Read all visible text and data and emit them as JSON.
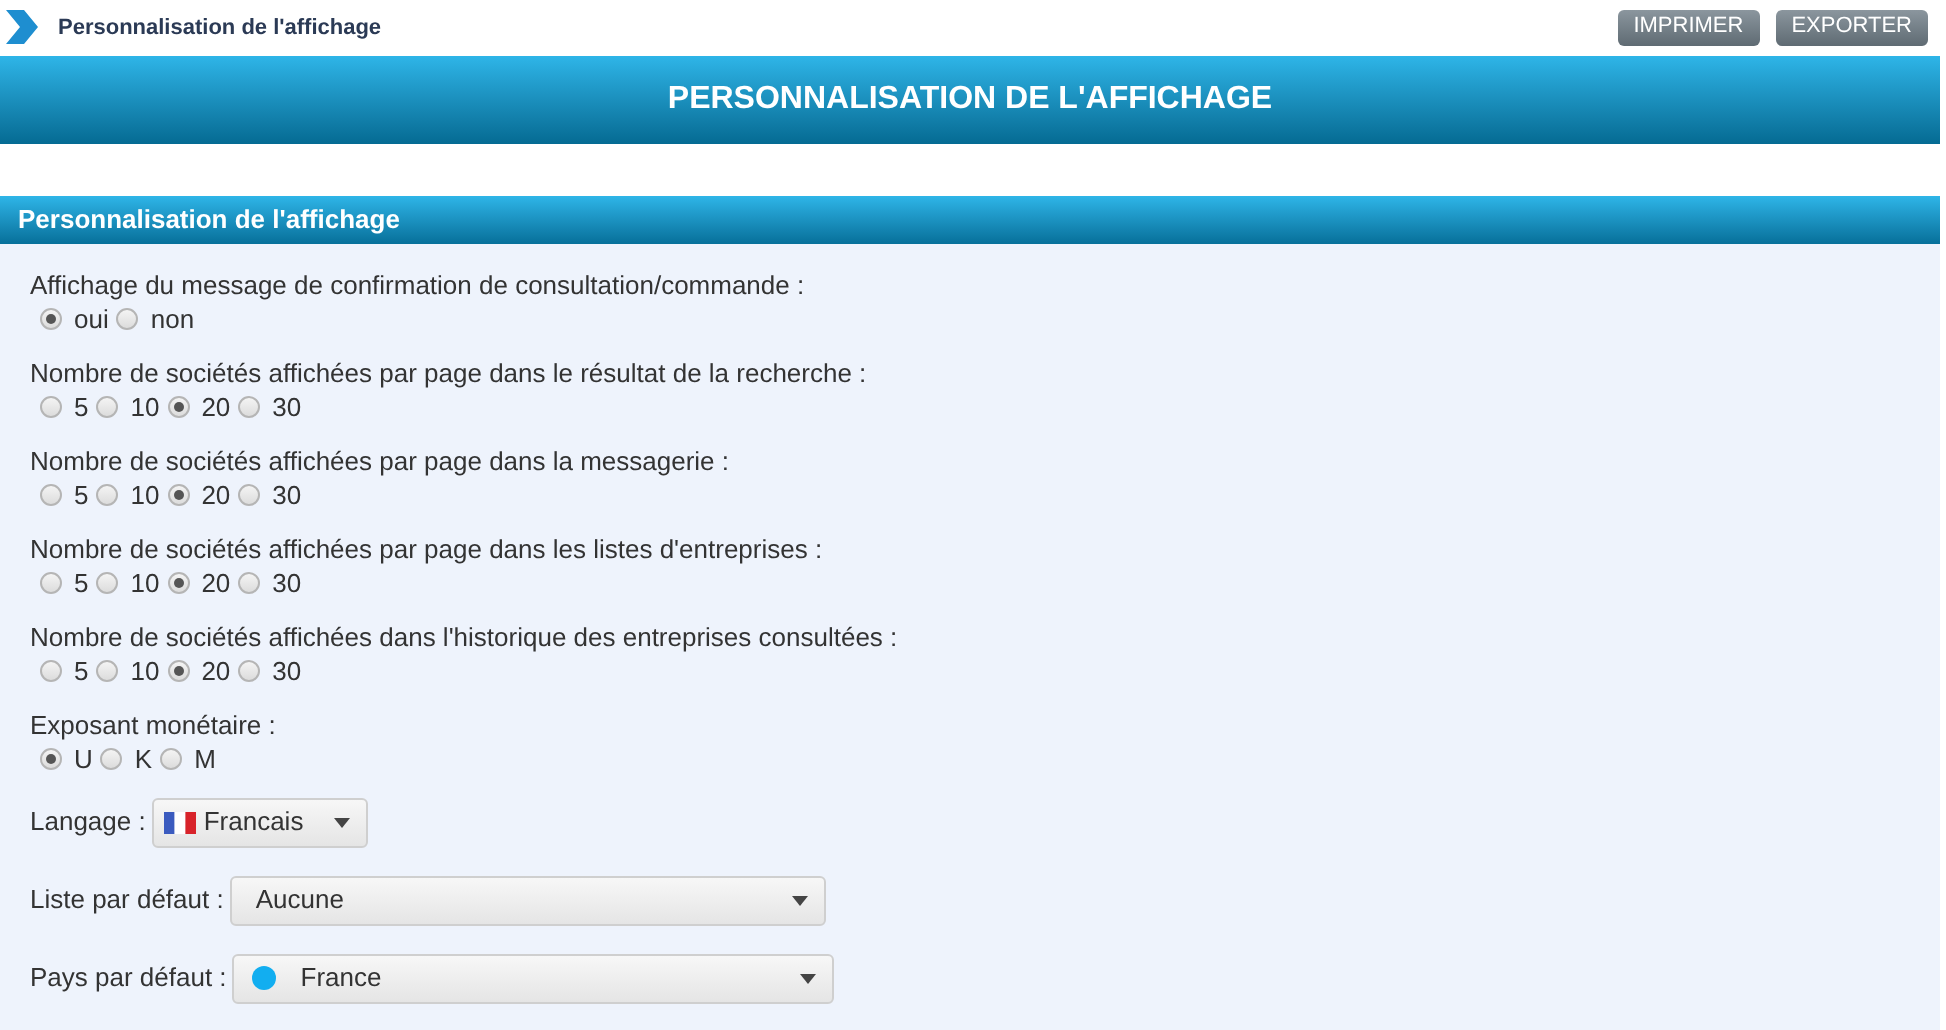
{
  "breadcrumb": "Personnalisation de l'affichage",
  "buttons": [
    "IMPRIMER",
    "EXPORTER"
  ],
  "page_title": "PERSONNALISATION DE L'AFFICHAGE",
  "section_title": "Personnalisation de l'affichage",
  "radio_groups": [
    {
      "label": "Affichage du message de confirmation de consultation/commande :",
      "options": [
        {
          "label": "oui",
          "selected": true
        },
        {
          "label": "non",
          "selected": false
        }
      ]
    },
    {
      "label": "Nombre de sociétés affichées par page dans le résultat de la recherche :",
      "options": [
        {
          "label": "5",
          "selected": false
        },
        {
          "label": "10",
          "selected": false
        },
        {
          "label": "20",
          "selected": true
        },
        {
          "label": "30",
          "selected": false
        }
      ]
    },
    {
      "label": "Nombre de sociétés affichées par page dans la messagerie :",
      "options": [
        {
          "label": "5",
          "selected": false
        },
        {
          "label": "10",
          "selected": false
        },
        {
          "label": "20",
          "selected": true
        },
        {
          "label": "30",
          "selected": false
        }
      ]
    },
    {
      "label": "Nombre de sociétés affichées par page dans les listes d'entreprises :",
      "options": [
        {
          "label": "5",
          "selected": false
        },
        {
          "label": "10",
          "selected": false
        },
        {
          "label": "20",
          "selected": true
        },
        {
          "label": "30",
          "selected": false
        }
      ]
    },
    {
      "label": "Nombre de sociétés affichées dans l'historique des entreprises consultées :",
      "options": [
        {
          "label": "5",
          "selected": false
        },
        {
          "label": "10",
          "selected": false
        },
        {
          "label": "20",
          "selected": true
        },
        {
          "label": "30",
          "selected": false
        }
      ]
    },
    {
      "label": "Exposant monétaire :",
      "options": [
        {
          "label": "U",
          "selected": true
        },
        {
          "label": "K",
          "selected": false
        },
        {
          "label": "M",
          "selected": false
        }
      ]
    }
  ],
  "selects": [
    {
      "label": "Langage :",
      "value": "Francais",
      "kind": "flag"
    },
    {
      "label": "Liste par défaut :",
      "value": "Aucune",
      "kind": "plain"
    },
    {
      "label": "Pays par défaut :",
      "value": "France",
      "kind": "dot"
    }
  ]
}
